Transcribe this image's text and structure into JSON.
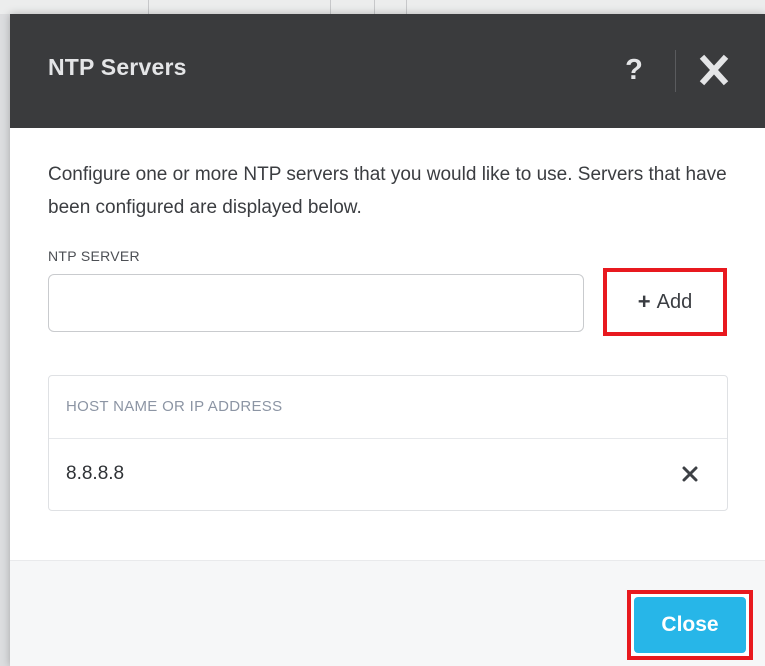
{
  "dialog": {
    "title": "NTP Servers",
    "help_label": "?",
    "intro": "Configure one or more NTP servers that you would like to use. Servers that have been configured are displayed below."
  },
  "form": {
    "field_label": "NTP SERVER",
    "server_value": "",
    "server_placeholder": "",
    "add_label": "Add"
  },
  "table": {
    "header": "HOST NAME OR IP ADDRESS",
    "rows": [
      {
        "host": "8.8.8.8"
      }
    ]
  },
  "footer": {
    "close_label": "Close"
  },
  "colors": {
    "header_bg": "#3a3b3d",
    "accent": "#27b6e8",
    "highlight": "#e8191f"
  },
  "icons": {
    "help": "question-icon",
    "close_dialog": "close-icon",
    "add": "plus-icon",
    "remove_row": "remove-icon"
  }
}
